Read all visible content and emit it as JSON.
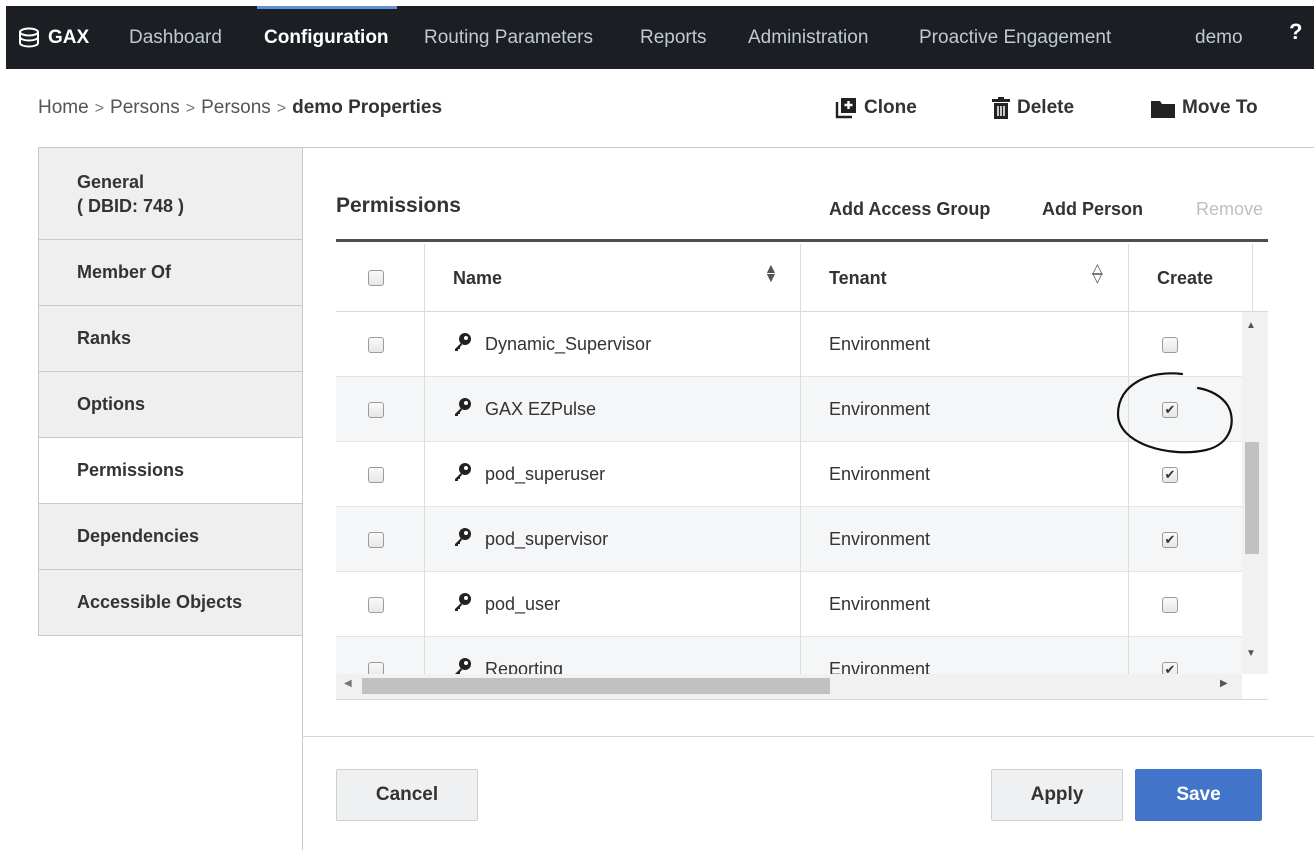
{
  "nav": {
    "logo": "GAX",
    "items": [
      "Dashboard",
      "Configuration",
      "Routing Parameters",
      "Reports",
      "Administration",
      "Proactive Engagement"
    ],
    "active": "Configuration",
    "user": "demo",
    "help": "?"
  },
  "breadcrumb": {
    "items": [
      "Home",
      "Persons",
      "Persons"
    ],
    "separator": ">",
    "current": "demo Properties"
  },
  "actions": {
    "clone": "Clone",
    "delete": "Delete",
    "move_to": "Move To"
  },
  "sidebar": {
    "general": {
      "title": "General",
      "dbid": "( DBID: 748 )"
    },
    "items": [
      "Member Of",
      "Ranks",
      "Options",
      "Permissions",
      "Dependencies",
      "Accessible Objects"
    ],
    "active": "Permissions"
  },
  "permissions": {
    "title": "Permissions",
    "add_access_group": "Add Access Group",
    "add_person": "Add Person",
    "remove": "Remove",
    "columns": {
      "name": "Name",
      "tenant": "Tenant",
      "create": "Create"
    },
    "rows": [
      {
        "name": "Dynamic_Supervisor",
        "tenant": "Environment",
        "create": false,
        "selected": false
      },
      {
        "name": "GAX EZPulse",
        "tenant": "Environment",
        "create": true,
        "selected": false
      },
      {
        "name": "pod_superuser",
        "tenant": "Environment",
        "create": true,
        "selected": false
      },
      {
        "name": "pod_supervisor",
        "tenant": "Environment",
        "create": true,
        "selected": false
      },
      {
        "name": "pod_user",
        "tenant": "Environment",
        "create": false,
        "selected": false
      },
      {
        "name": "Reporting",
        "tenant": "Environment",
        "create": true,
        "selected": false
      }
    ]
  },
  "footer": {
    "cancel": "Cancel",
    "apply": "Apply",
    "save": "Save"
  },
  "colors": {
    "nav_bg": "#1b1f24",
    "primary": "#4275c9",
    "active_accent": "#5e93d6"
  },
  "icons": [
    "database-stack-icon",
    "clone-icon",
    "trash-icon",
    "folder-icon",
    "key-icon",
    "sort-icon"
  ]
}
